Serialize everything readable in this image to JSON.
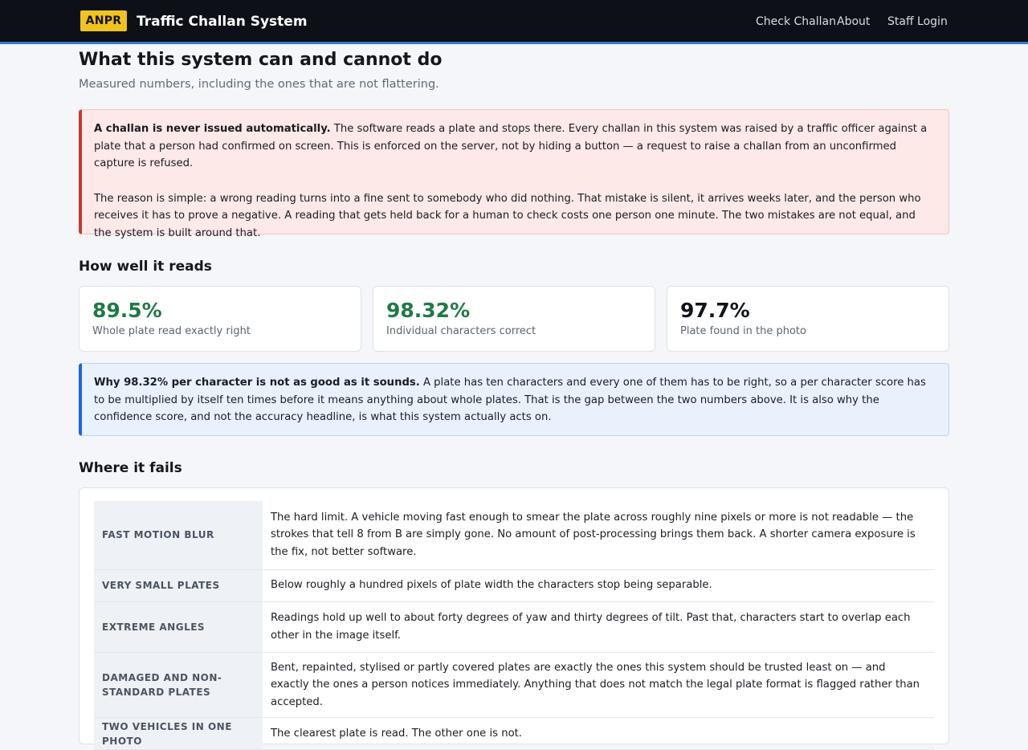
{
  "nav": {
    "badge": "ANPR",
    "title": "Traffic Challan System",
    "links": [
      "Check Challan",
      "About",
      "Staff Login"
    ]
  },
  "page": {
    "title": "What this system can and cannot do",
    "subtitle": "Measured numbers, including the ones that are not flattering."
  },
  "warning": {
    "lead": "A challan is never issued automatically.",
    "body": " The software reads a plate and stops there. Every challan in this system was raised by a traffic officer against a plate that a person had confirmed on screen. This is enforced on the server, not by hiding a button — a request to raise a challan from an unconfirmed capture is refused.",
    "reason": "The reason is simple: a wrong reading turns into a fine sent to somebody who did nothing. That mistake is silent, it arrives weeks later, and the person who receives it has to prove a negative. A reading that gets held back for a human to check costs one person one minute. The two mistakes are not equal, and the system is built around that."
  },
  "reads": {
    "heading": "How well it reads",
    "stats": [
      {
        "value": "89.5%",
        "label": "Whole plate read exactly right",
        "color": "#1f7a45"
      },
      {
        "value": "98.32%",
        "label": "Individual characters correct",
        "color": "#1f7a45"
      },
      {
        "value": "97.7%",
        "label": "Plate found in the photo",
        "color": "#111418"
      }
    ]
  },
  "note": {
    "lead": "Why 98.32% per character is not as good as it sounds.",
    "body": " A plate has ten characters and every one of them has to be right, so a per character score has to be multiplied by itself ten times before it means anything about whole plates. That is the gap between the two numbers above. It is also why the confidence score, and not the accuracy headline, is what this system actually acts on."
  },
  "fails": {
    "heading": "Where it fails",
    "rows": [
      {
        "key": "FAST MOTION BLUR",
        "desc": "The hard limit. A vehicle moving fast enough to smear the plate across roughly nine pixels or more is not readable — the strokes that tell 8 from B are simply gone. No amount of post-processing brings them back. A shorter camera exposure is the fix, not better software."
      },
      {
        "key": "VERY SMALL PLATES",
        "desc": "Below roughly a hundred pixels of plate width the characters stop being separable."
      },
      {
        "key": "EXTREME ANGLES",
        "desc": "Readings hold up well to about forty degrees of yaw and thirty degrees of tilt. Past that, characters start to overlap each other in the image itself."
      },
      {
        "key": "DAMAGED AND NON-STANDARD PLATES",
        "desc": "Bent, repainted, stylised or partly covered plates are exactly the ones this system should be trusted least on — and exactly the ones a person notices immediately. Anything that does not match the legal plate format is flagged rather than accepted."
      },
      {
        "key": "TWO VEHICLES IN ONE PHOTO",
        "desc": "The clearest plate is read. The other one is not."
      }
    ]
  },
  "colors": {
    "navbar": "#0d1117",
    "accent": "#2f7ad6",
    "badge": "#f2c31b",
    "warning_border": "#c23b2e",
    "note_border": "#1f66d1",
    "good": "#1f7a45"
  }
}
